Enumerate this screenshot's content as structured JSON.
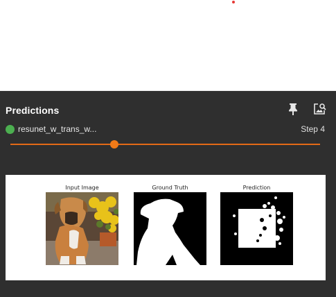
{
  "panel": {
    "title": "Predictions",
    "run_name": "resunet_w_trans_w...",
    "run_color": "#4caf50",
    "step_label": "Step 4",
    "slider": {
      "value_fraction": 0.335
    },
    "accent_color": "#e36a17",
    "icons": [
      "pin-icon",
      "image-search-icon"
    ]
  },
  "prediction_image": {
    "panels": [
      {
        "title": "Input Image"
      },
      {
        "title": "Ground Truth"
      },
      {
        "title": "Prediction"
      }
    ]
  }
}
